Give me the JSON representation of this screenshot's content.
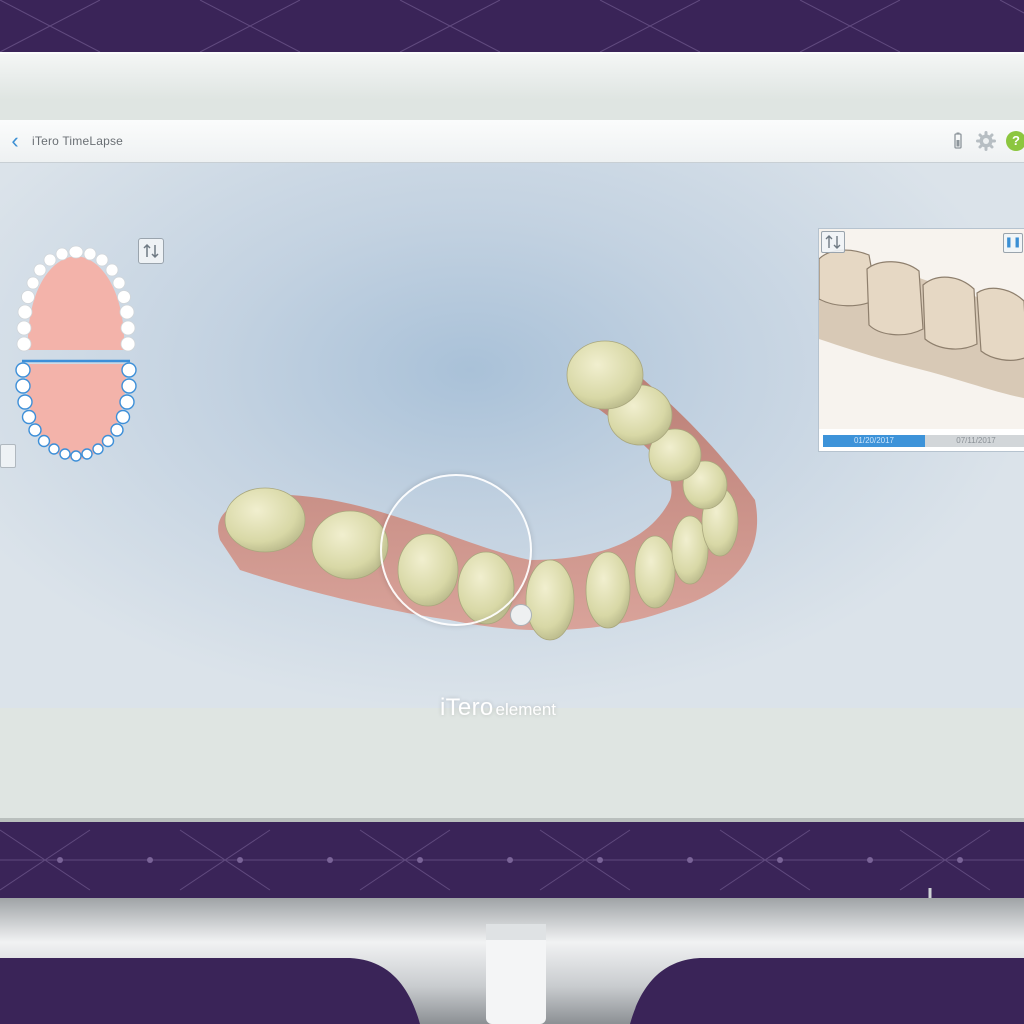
{
  "header": {
    "back_icon": "chevron-left-icon",
    "title": "iTero TimeLapse",
    "icons": [
      "battery-icon",
      "gear-icon",
      "help-icon"
    ],
    "help_glyph": "?"
  },
  "arch_selector": {
    "selected": "lower",
    "swap_icon": "swap-arch-icon"
  },
  "preview": {
    "swap_icon": "swap-view-icon",
    "pause_icon": "pause-icon",
    "pause_glyph": "❚❚",
    "dates": [
      "01/20/2017",
      "07/11/2017"
    ],
    "active_date_index": 0
  },
  "brand": {
    "name": "iTero",
    "suffix": "element"
  },
  "colors": {
    "accent": "#3d93d9",
    "help": "#8cc63f",
    "backdrop": "#3a2458",
    "gum": "#c98e84",
    "tooth": "#e3e2b6"
  }
}
